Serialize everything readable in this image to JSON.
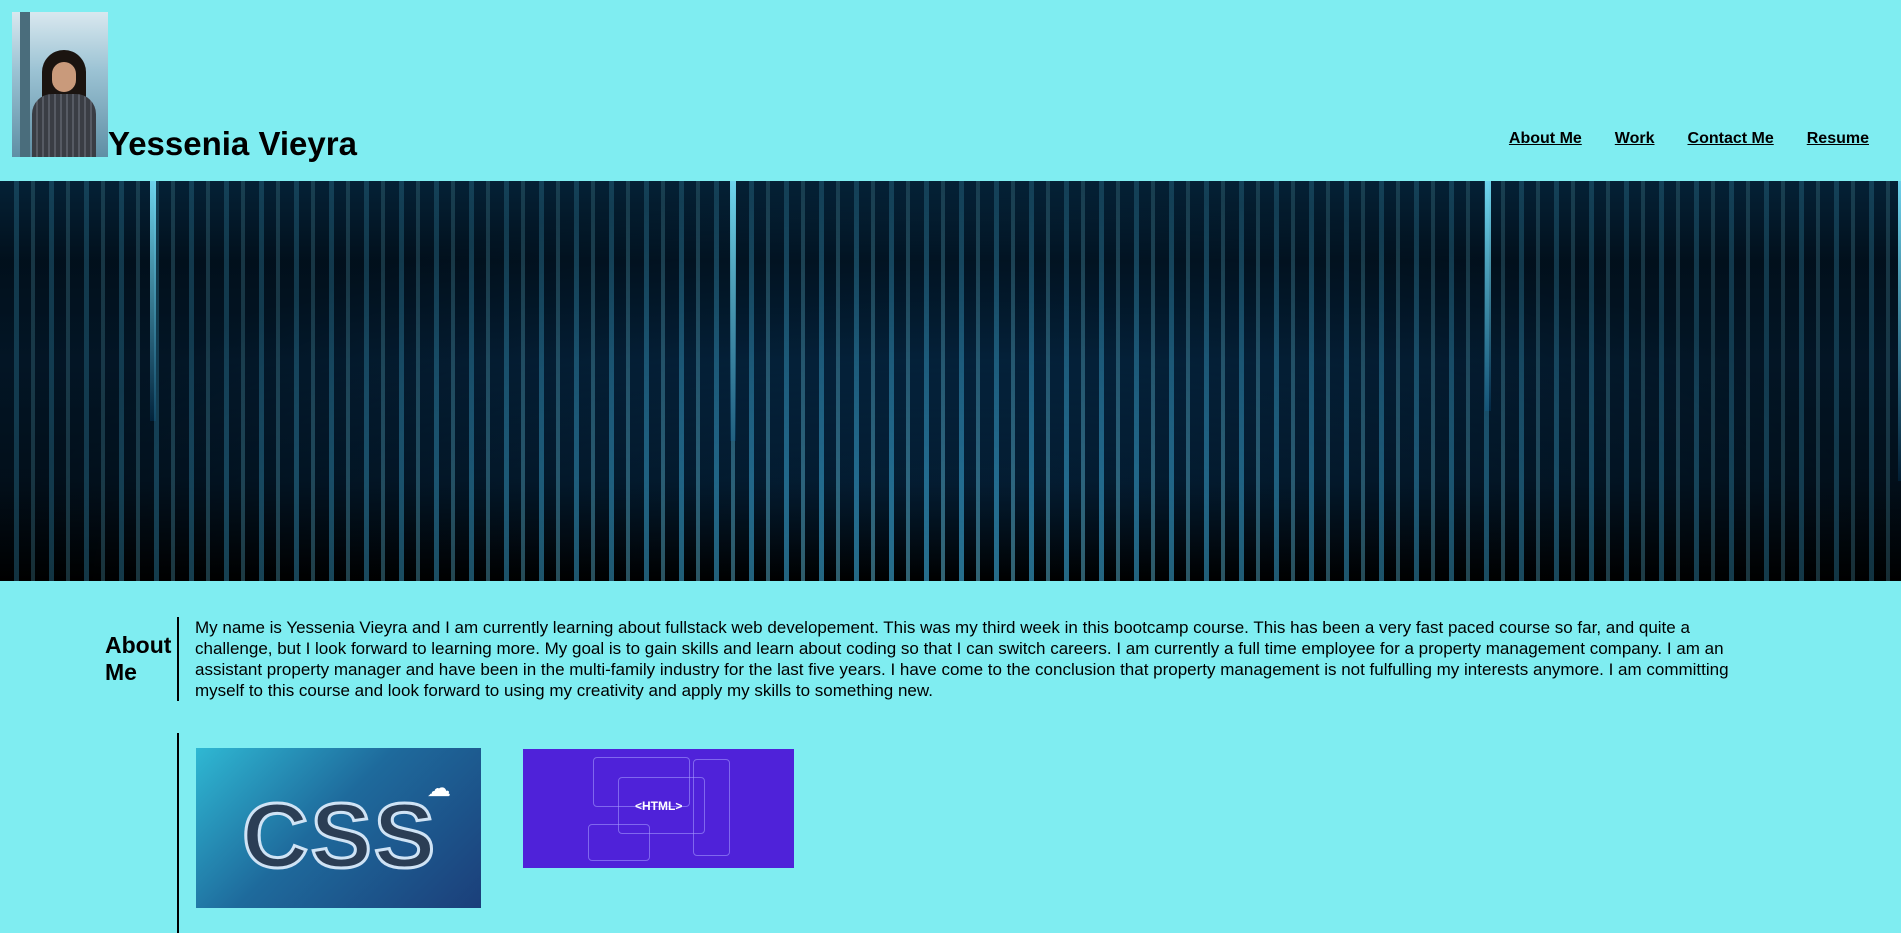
{
  "header": {
    "title": "Yessenia Vieyra",
    "nav": [
      {
        "label": "About Me"
      },
      {
        "label": "Work"
      },
      {
        "label": "Contact Me"
      },
      {
        "label": "Resume"
      }
    ]
  },
  "about": {
    "heading": "About Me",
    "text": "My name is Yessenia Vieyra and I am currently learning about fullstack web developement. This was my third week in this bootcamp course. This has been a very fast paced course so far, and quite a challenge, but I look forward to learning more. My goal is to gain skills and learn about coding so that I can switch careers. I am currently a full time employee for a property management company. I am an assistant property manager and have been in the multi-family industry for the last five years. I have come to the conclusion that property management is not fulfulling my interests anymore. I am committing myself to this course and look forward to using my creativity and apply my skills to something new."
  },
  "work": {
    "tiles": [
      {
        "label": "CSS"
      },
      {
        "label": "<HTML>"
      }
    ]
  },
  "colors": {
    "page_background": "#7fedf1",
    "html_tile_background": "#4f22d9"
  }
}
